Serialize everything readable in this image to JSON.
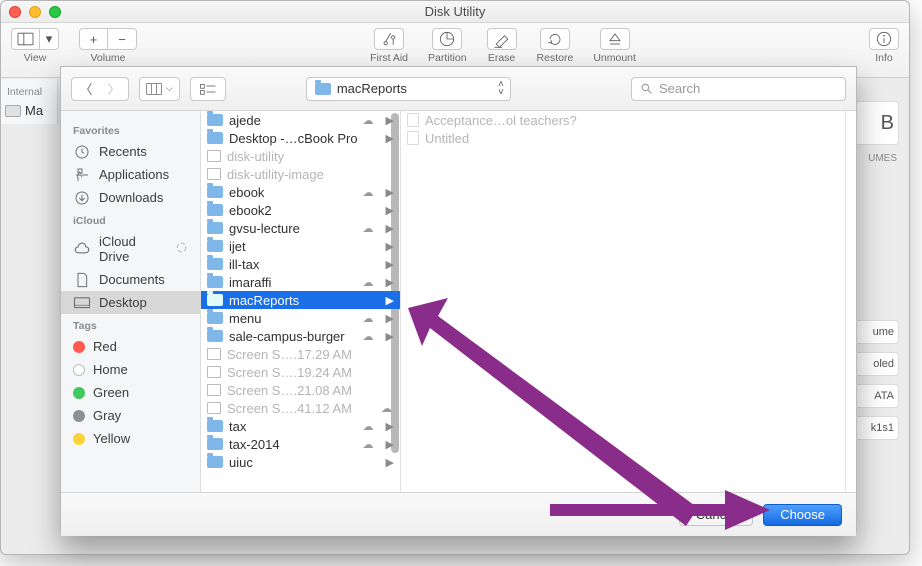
{
  "window": {
    "title": "Disk Utility"
  },
  "toolbar": {
    "view": "View",
    "volume": "Volume",
    "first_aid": "First Aid",
    "partition": "Partition",
    "erase": "Erase",
    "restore": "Restore",
    "unmount": "Unmount",
    "info": "Info"
  },
  "side": {
    "header": "Internal",
    "item": "Ma"
  },
  "right_stubs": {
    "top": "B",
    "umes": "UMES",
    "c1": "ume",
    "c2": "oled",
    "c3": "ATA",
    "c4": "k1s1"
  },
  "sheet": {
    "path": "macReports",
    "search_placeholder": "Search"
  },
  "sidebar": {
    "favorites": "Favorites",
    "items_fav": [
      {
        "icon": "clock",
        "label": "Recents"
      },
      {
        "icon": "app",
        "label": "Applications"
      },
      {
        "icon": "down",
        "label": "Downloads"
      }
    ],
    "icloud_h": "iCloud",
    "items_cloud": [
      {
        "icon": "cloud",
        "label": "iCloud Drive",
        "busy": true
      },
      {
        "icon": "doc",
        "label": "Documents"
      },
      {
        "icon": "desk",
        "label": "Desktop",
        "sel": true
      }
    ],
    "tags_h": "Tags",
    "tags": [
      {
        "color": "#ff5a4d",
        "label": "Red"
      },
      {
        "color": "#ffffff",
        "label": "Home",
        "border": "#bcbcbc"
      },
      {
        "color": "#40c95e",
        "label": "Green"
      },
      {
        "color": "#8e8e93",
        "label": "Gray"
      },
      {
        "color": "#ffd23a",
        "label": "Yellow"
      }
    ]
  },
  "col1": [
    {
      "type": "folder",
      "name": "ajede",
      "cloud": true,
      "arrow": true
    },
    {
      "type": "folder",
      "name": "Desktop -…cBook Pro",
      "arrow": true
    },
    {
      "type": "dim",
      "name": "disk-utility"
    },
    {
      "type": "dim",
      "name": "disk-utility-image"
    },
    {
      "type": "folder",
      "name": "ebook",
      "cloud": true,
      "arrow": true
    },
    {
      "type": "folder",
      "name": "ebook2",
      "arrow": true
    },
    {
      "type": "folder",
      "name": "gvsu-lecture",
      "cloud": true,
      "arrow": true
    },
    {
      "type": "folder",
      "name": "ijet",
      "arrow": true
    },
    {
      "type": "folder",
      "name": "ill-tax",
      "arrow": true
    },
    {
      "type": "folder",
      "name": "imaraffi",
      "cloud": true,
      "arrow": true
    },
    {
      "type": "folder",
      "name": "macReports",
      "arrow": true,
      "sel": true
    },
    {
      "type": "folder",
      "name": "menu",
      "cloud": true,
      "arrow": true
    },
    {
      "type": "folder",
      "name": "sale-campus-burger",
      "cloud": true,
      "arrow": true
    },
    {
      "type": "dim",
      "name": "Screen S….17.29 AM"
    },
    {
      "type": "dim",
      "name": "Screen S….19.24 AM"
    },
    {
      "type": "dim",
      "name": "Screen S….21.08 AM"
    },
    {
      "type": "dim",
      "name": "Screen S….41.12 AM",
      "cloud": true
    },
    {
      "type": "folder",
      "name": "tax",
      "cloud": true,
      "arrow": true
    },
    {
      "type": "folder",
      "name": "tax-2014",
      "cloud": true,
      "arrow": true
    },
    {
      "type": "folder",
      "name": "uiuc",
      "arrow": true
    }
  ],
  "col2": [
    {
      "type": "docdim",
      "name": "Acceptance…ol teachers?"
    },
    {
      "type": "docdim",
      "name": "Untitled"
    }
  ],
  "buttons": {
    "cancel": "Cancel",
    "choose": "Choose"
  }
}
